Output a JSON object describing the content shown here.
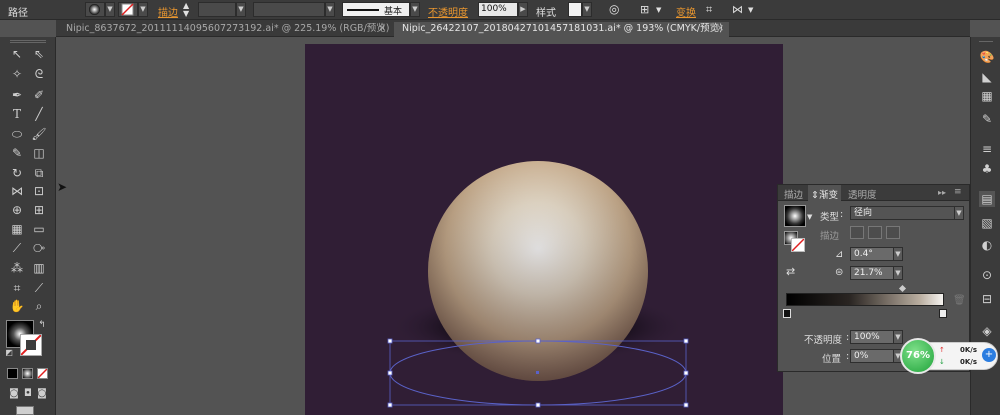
{
  "control_bar": {
    "object_type": "路径",
    "stroke_label": "描边",
    "stroke_style_label": "基本",
    "opacity_label": "不透明度",
    "opacity_value": "100%",
    "style_label": "样式",
    "transform_label": "变换"
  },
  "tabs": [
    {
      "label": "Nipic_8637672_20111114095607273192.ai* @ 225.19% (RGB/预览)",
      "active": false
    },
    {
      "label": "Nipic_26422107_20180427101457181031.ai* @ 193% (CMYK/预览)",
      "active": true
    }
  ],
  "gradient_panel": {
    "tabs": [
      "描边",
      "渐变",
      "透明度"
    ],
    "active_tab": "渐变",
    "type_label": "类型",
    "type_value": "径向",
    "stroke_label": "描边",
    "angle_value": "0.4°",
    "aspect_value": "21.7%",
    "opacity_label": "不透明度",
    "opacity_value": "100%",
    "position_label": "位置",
    "position_value": "0%"
  },
  "speed_widget": {
    "percent": "76%",
    "upload": "0K/s",
    "download": "0K/s"
  },
  "colors": {
    "artboard": "#301e35",
    "accent_orange": "#e8962f",
    "selection": "#5a62c8"
  }
}
